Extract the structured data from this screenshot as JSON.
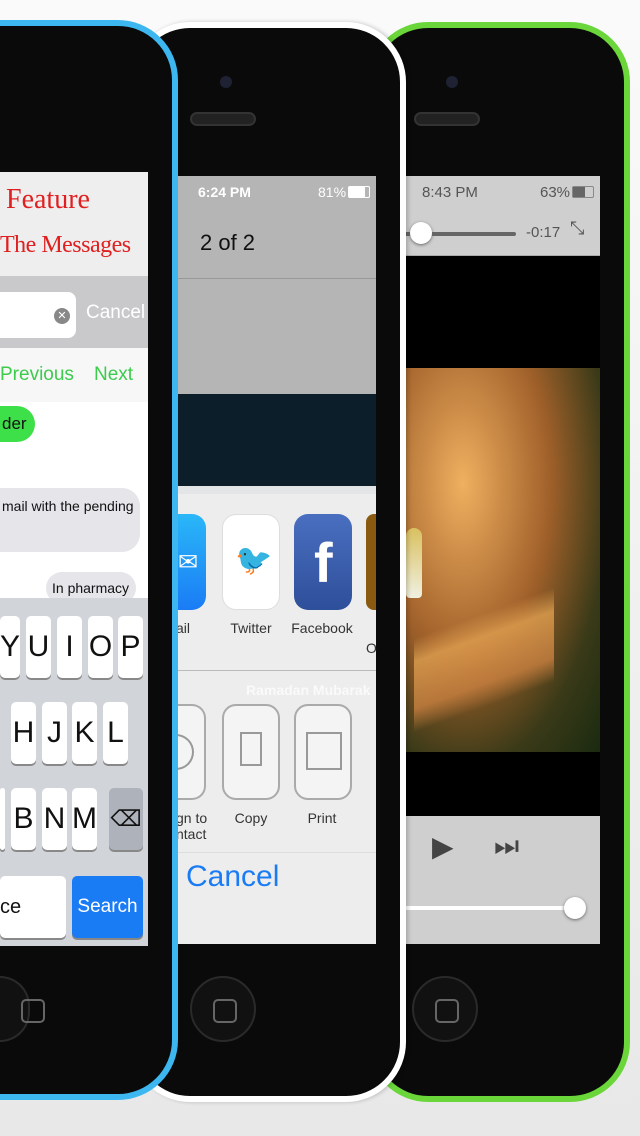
{
  "colors": {
    "blue_phone": "#3db7f0",
    "white_phone": "#ffffff",
    "green_phone": "#6ad63a",
    "ios_blue": "#1a7cf5",
    "green_text": "#3ccb4c",
    "title_red": "#e02020"
  },
  "left_phone": {
    "banner": [
      "Feature",
      "The Messages"
    ],
    "search": {
      "value": "",
      "cancel": "Cancel"
    },
    "nav": {
      "previous": "Previous",
      "next": "Next"
    },
    "messages": [
      {
        "text": "der",
        "type": "sent"
      },
      {
        "text": "mail with the pending",
        "type": "received"
      },
      {
        "text": "In pharmacy",
        "type": "received"
      }
    ],
    "keyboard": {
      "row1": [
        "Y",
        "U",
        "I",
        "O",
        "P"
      ],
      "row2": [
        "H",
        "J",
        "K",
        "L"
      ],
      "row3": [
        "B",
        "N",
        "M"
      ],
      "space": "ce",
      "search": "Search"
    }
  },
  "middle_phone": {
    "status": {
      "time": "6:24 PM",
      "battery": "81%"
    },
    "title": "2 of 2",
    "image_caption": "Ramadan Mubarak",
    "share_apps": [
      {
        "label": "ail",
        "icon": "mail-icon"
      },
      {
        "label": "Twitter",
        "icon": "twitter-icon"
      },
      {
        "label": "Facebook",
        "icon": "facebook-icon"
      },
      {
        "label": "O",
        "icon": "app-icon"
      }
    ],
    "actions": [
      {
        "label": "gn to\nntact",
        "icon": "contact-icon"
      },
      {
        "label": "Copy",
        "icon": "copy-icon"
      },
      {
        "label": "Print",
        "icon": "print-icon"
      }
    ],
    "cancel": "Cancel"
  },
  "right_phone": {
    "status": {
      "time": "8:43 PM",
      "battery": "63%"
    },
    "player": {
      "remaining": "-0:17",
      "progress": 0.05,
      "volume": 1.0
    }
  }
}
